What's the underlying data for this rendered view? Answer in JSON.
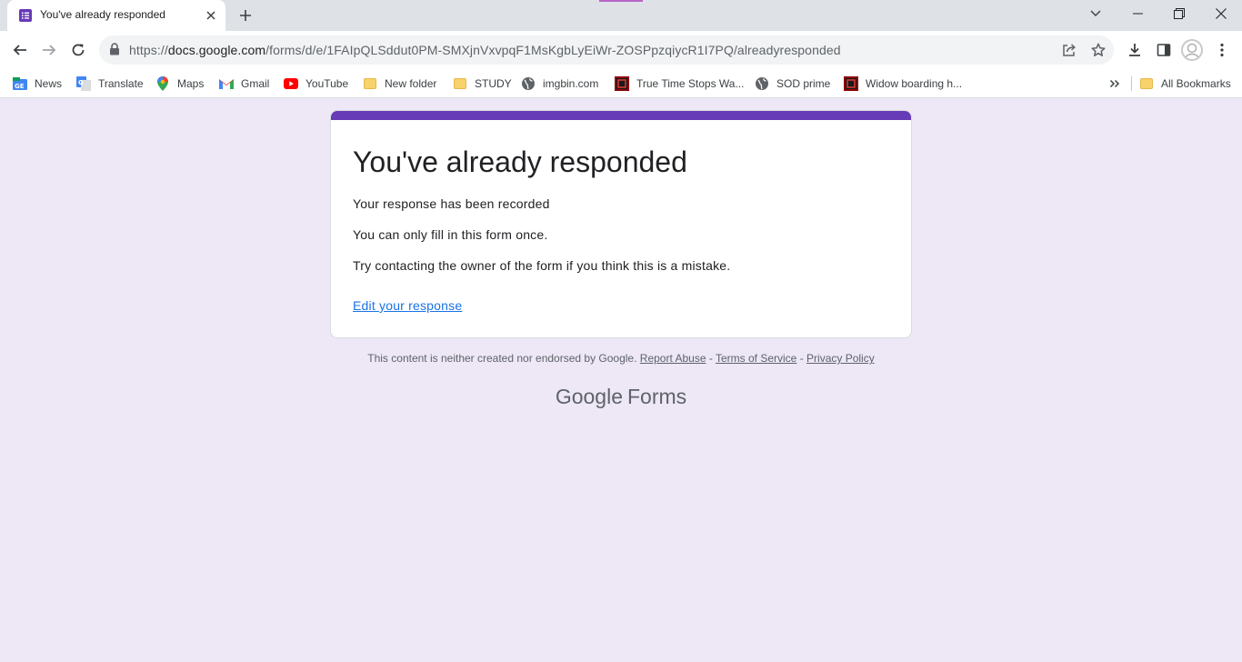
{
  "browser": {
    "tab": {
      "title": "You've already responded"
    },
    "url": {
      "host": "docs.google.com",
      "path": "/forms/d/e/1FAIpQLSddut0PM-SMXjnVxvpqF1MsKgbLyEiWr-ZOSPpzqiycR1I7PQ/alreadyresponded"
    },
    "bookmarks": [
      {
        "label": "News",
        "icon": "google-news-icon"
      },
      {
        "label": "Translate",
        "icon": "google-translate-icon"
      },
      {
        "label": "Maps",
        "icon": "google-maps-icon"
      },
      {
        "label": "Gmail",
        "icon": "gmail-icon"
      },
      {
        "label": "YouTube",
        "icon": "youtube-icon"
      },
      {
        "label": "New folder",
        "icon": "folder-icon"
      },
      {
        "label": "STUDY",
        "icon": "folder-icon"
      },
      {
        "label": "imgbin.com",
        "icon": "globe-icon"
      },
      {
        "label": "True Time Stops Wa...",
        "icon": "site-icon"
      },
      {
        "label": "SOD prime",
        "icon": "globe-icon"
      },
      {
        "label": "Widow boarding h...",
        "icon": "site-icon"
      }
    ],
    "all_bookmarks": "All Bookmarks"
  },
  "form": {
    "title": "You've already responded",
    "line1": "Your response has been recorded",
    "line2": "You can only fill in this form once.",
    "line3": "Try contacting the owner of the form if you think this is a mistake.",
    "edit_link": "Edit your response",
    "accent_color": "#673ab7"
  },
  "footer": {
    "disclaimer": "This content is neither created nor endorsed by Google.",
    "report_abuse": "Report Abuse",
    "terms": "Terms of Service",
    "privacy": "Privacy Policy",
    "sep": "-",
    "brand_google": "Google",
    "brand_forms": "Forms"
  },
  "colors": {
    "page_background": "#ede7f6",
    "link": "#1a73e8"
  }
}
